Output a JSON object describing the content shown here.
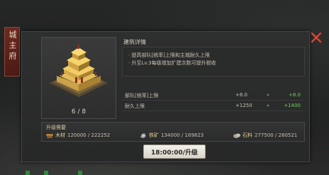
{
  "side_tab": {
    "label": "城主府"
  },
  "building": {
    "level_text": "6 / 8"
  },
  "details": {
    "title": "建筑详情",
    "description": [
      "· 提高部队[统率]上限和主城耐久上限",
      "· 升至Lv.3每级增加扩建次数可提升税收"
    ],
    "stats": [
      {
        "name": "部队[统率]上限",
        "current": "+8.0",
        "arrow": "»",
        "next": "+8.0"
      },
      {
        "name": "耐久上限",
        "current": "+1250",
        "arrow": "»",
        "next": "+1400"
      }
    ]
  },
  "upgrade": {
    "title": "升级需要",
    "resources": [
      {
        "name": "木材",
        "amount": "120000 / 222252",
        "icon": "wood-icon"
      },
      {
        "name": "铁矿",
        "amount": "134000 / 169823",
        "icon": "iron-icon"
      },
      {
        "name": "石料",
        "amount": "277500 / 280521",
        "icon": "stone-icon"
      }
    ],
    "button_label": "18:00:00/升级"
  },
  "colors": {
    "accent_red": "#d8453a",
    "stat_green": "#6fcf5a",
    "tab_red": "#6d2a22"
  }
}
